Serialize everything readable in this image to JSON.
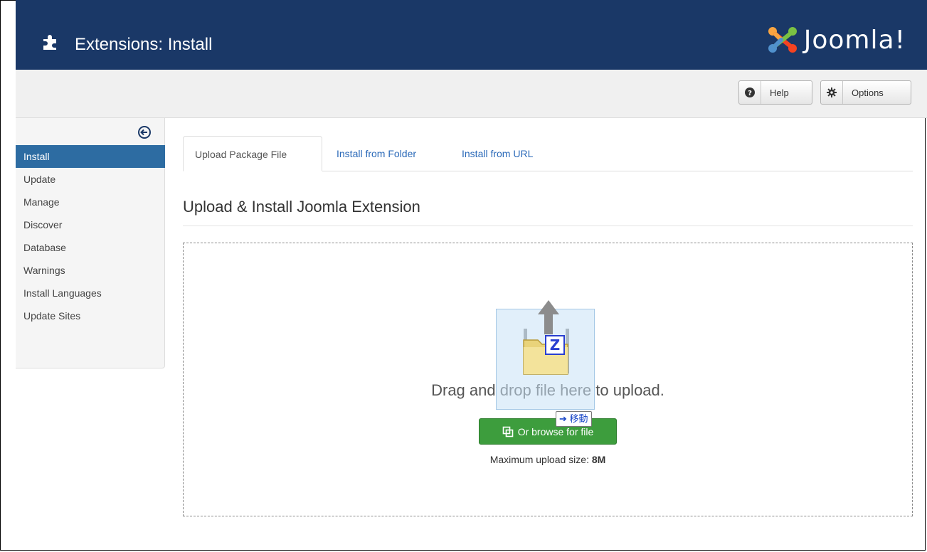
{
  "header": {
    "title": "Extensions: Install",
    "logo_text": "Joomla!"
  },
  "toolbar": {
    "help_label": "Help",
    "options_label": "Options"
  },
  "sidebar": {
    "items": [
      {
        "label": "Install",
        "active": true
      },
      {
        "label": "Update"
      },
      {
        "label": "Manage"
      },
      {
        "label": "Discover"
      },
      {
        "label": "Database"
      },
      {
        "label": "Warnings"
      },
      {
        "label": "Install Languages"
      },
      {
        "label": "Update Sites"
      }
    ]
  },
  "tabs": [
    {
      "label": "Upload Package File",
      "active": true
    },
    {
      "label": "Install from Folder"
    },
    {
      "label": "Install from URL"
    }
  ],
  "main": {
    "title": "Upload & Install Joomla Extension",
    "drop_text": "Drag and drop file here to upload.",
    "browse_label": "Or browse for file",
    "max_size_label": "Maximum upload size: ",
    "max_size_value": "8M"
  },
  "drag": {
    "badge": "Z",
    "tooltip": "➔ 移動"
  },
  "colors": {
    "header_bg": "#1a3867",
    "active_blue": "#2d6ca2",
    "browse_green": "#3d9d3d",
    "link": "#2a69b8"
  }
}
